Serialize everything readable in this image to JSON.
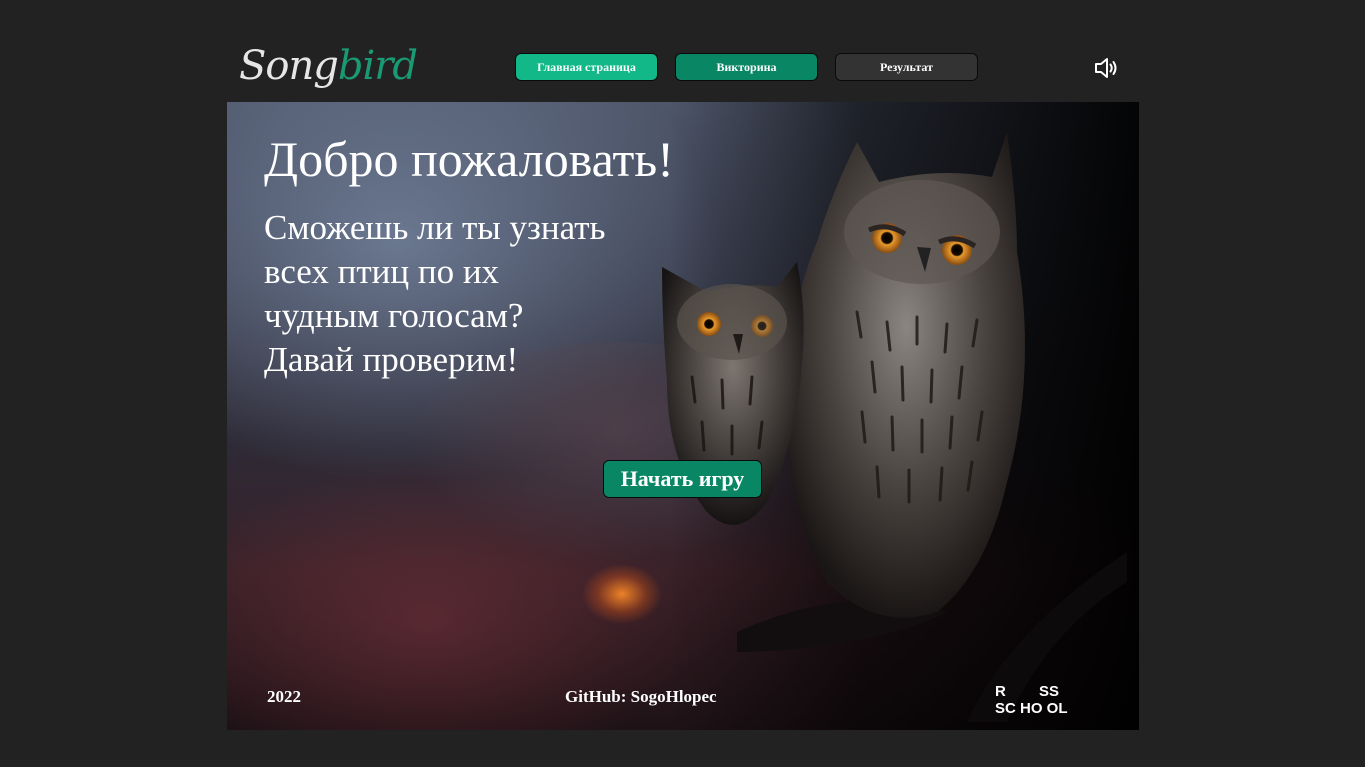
{
  "header": {
    "logo_part1": "Song",
    "logo_part2": "bird",
    "nav": {
      "home": "Главная страница",
      "quiz": "Викторина",
      "result": "Результат"
    },
    "sound_icon": "speaker-icon"
  },
  "main": {
    "title": "Добро пожаловать!",
    "intro_lines": [
      "Сможешь ли ты узнать",
      "всех птиц по их",
      "чудным голосам?",
      "Давай проверим!"
    ],
    "start_button": "Начать игру"
  },
  "footer": {
    "year": "2022",
    "github": "GitHub: SogoHlopec",
    "school_logo": {
      "row1_left": "R",
      "row1_right": "SS",
      "row2": "SC HO OL"
    }
  },
  "colors": {
    "background": "#222222",
    "accent_home": "#12b887",
    "accent_quiz": "#098765",
    "button_dark": "#333333",
    "logo_accent": "#1a9a72"
  }
}
